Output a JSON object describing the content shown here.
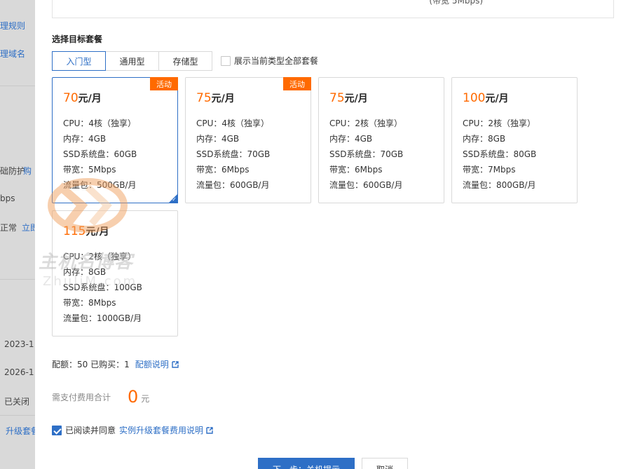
{
  "backdrop": {
    "items": [
      {
        "text": "理规则",
        "type": "link"
      },
      {
        "text": "理域名",
        "type": "link"
      },
      {
        "text": "础防护",
        "type": "text"
      },
      {
        "text": "购",
        "type": "link"
      },
      {
        "text": "bps",
        "type": "text"
      },
      {
        "text": "正常",
        "type": "text"
      },
      {
        "text": "立即",
        "type": "link"
      },
      {
        "text": "2023-1",
        "type": "text"
      },
      {
        "text": "2026-1",
        "type": "text"
      },
      {
        "text": "已关闭",
        "type": "text"
      },
      {
        "text": "升级套餐",
        "type": "link"
      }
    ]
  },
  "prev_section": {
    "text": "(带宽 5Mbps)"
  },
  "section_title": "选择目标套餐",
  "tabs": [
    {
      "label": "入门型",
      "active": true
    },
    {
      "label": "通用型",
      "active": false
    },
    {
      "label": "存储型",
      "active": false
    }
  ],
  "show_all": {
    "label": "展示当前类型全部套餐",
    "checked": false
  },
  "plans": [
    {
      "price": "70",
      "unit": "元/月",
      "badge": "活动",
      "selected": true,
      "cpu": "CPU：4核（独享）",
      "mem": "内存：4GB",
      "disk": "SSD系统盘：60GB",
      "bw": "带宽：5Mbps",
      "traffic": "流量包：500GB/月"
    },
    {
      "price": "75",
      "unit": "元/月",
      "badge": "活动",
      "selected": false,
      "cpu": "CPU：4核（独享）",
      "mem": "内存：4GB",
      "disk": "SSD系统盘：70GB",
      "bw": "带宽：6Mbps",
      "traffic": "流量包：600GB/月"
    },
    {
      "price": "75",
      "unit": "元/月",
      "badge": "",
      "selected": false,
      "cpu": "CPU：2核（独享）",
      "mem": "内存：4GB",
      "disk": "SSD系统盘：70GB",
      "bw": "带宽：6Mbps",
      "traffic": "流量包：600GB/月"
    },
    {
      "price": "100",
      "unit": "元/月",
      "badge": "",
      "selected": false,
      "cpu": "CPU：2核（独享）",
      "mem": "内存：8GB",
      "disk": "SSD系统盘：80GB",
      "bw": "带宽：7Mbps",
      "traffic": "流量包：800GB/月"
    },
    {
      "price": "115",
      "unit": "元/月",
      "badge": "",
      "selected": false,
      "cpu": "CPU：2核（独享）",
      "mem": "内存：8GB",
      "disk": "SSD系统盘：100GB",
      "bw": "带宽：8Mbps",
      "traffic": "流量包：1000GB/月"
    }
  ],
  "quota": {
    "text": "配额：50  已购买：1",
    "link": "配额说明"
  },
  "cost": {
    "label": "需支付费用合计",
    "amount": "0",
    "unit": "元"
  },
  "agree": {
    "label": "已阅读并同意",
    "link": "实例升级套餐费用说明",
    "checked": true
  },
  "buttons": {
    "next": "下一步：关机提示",
    "cancel": "取消"
  },
  "watermark": {
    "text": "主机名博客",
    "sub": "ZhuJiM.com"
  },
  "colors": {
    "accent": "#2e6fc6",
    "price": "#ff6a00",
    "badge": "#ff6a00"
  }
}
